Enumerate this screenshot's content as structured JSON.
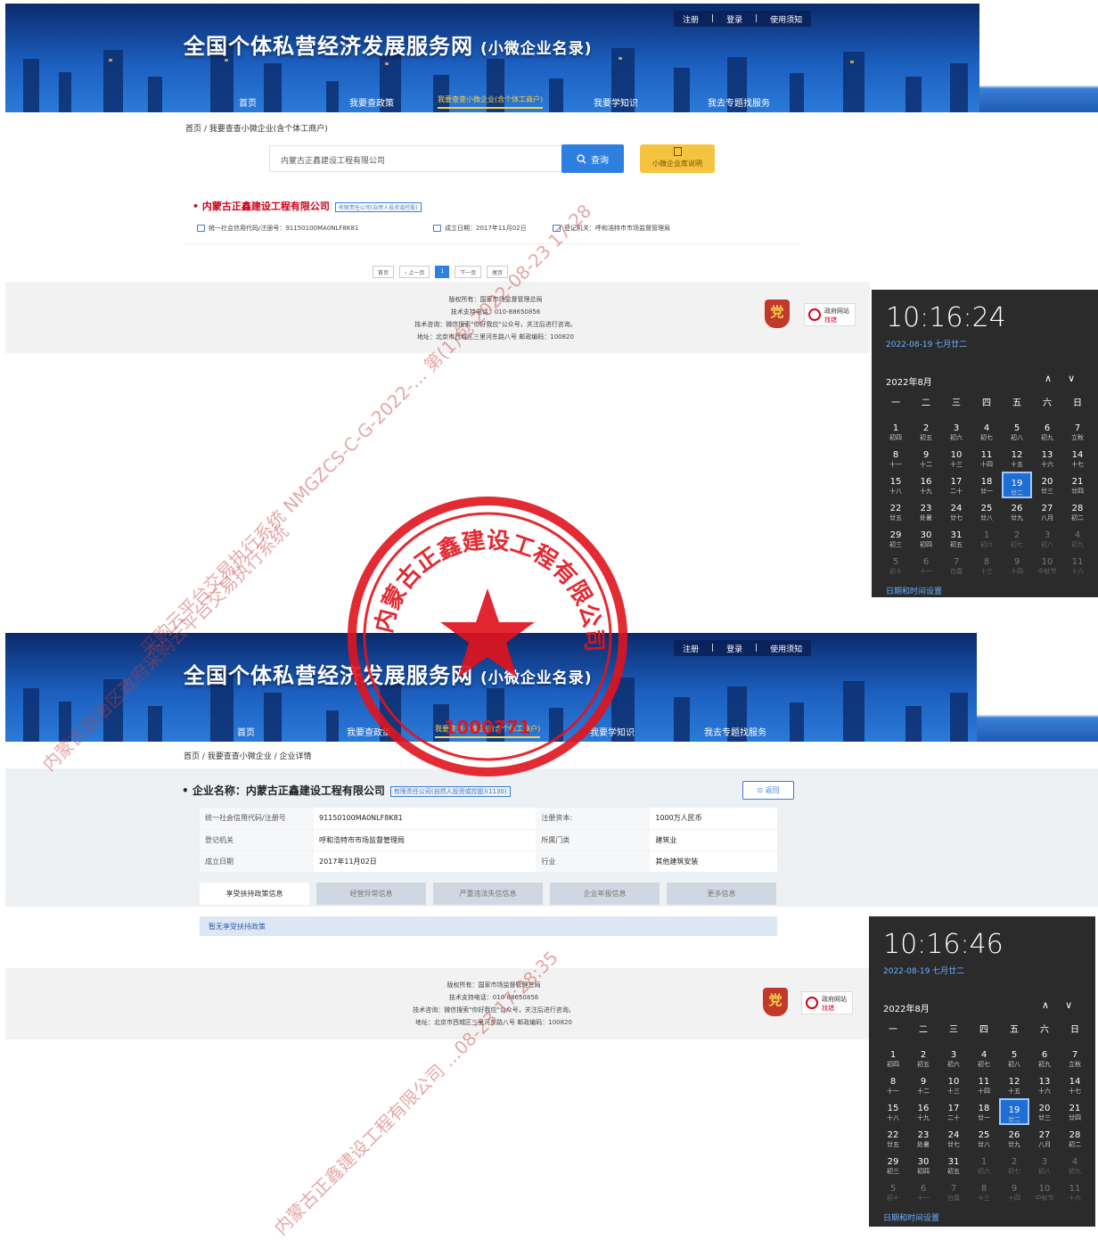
{
  "site": {
    "title": "全国个体私营经济发展服务网",
    "subtitle": "(小微企业名录)",
    "top_links": [
      "注册",
      "|",
      "登录",
      "|",
      "使用须知"
    ],
    "nav": [
      "首页",
      "我要查政策",
      "我要查查小微企业(含个体工商户)",
      "我要学知识",
      "我去专题找服务"
    ]
  },
  "page1": {
    "breadcrumb": "首页 / 我要查查小微企业(含个体工商户)",
    "search": {
      "value": "内蒙古正鑫建设工程有限公司",
      "button": "查询",
      "guide_button": "小微企业库说明"
    },
    "result": {
      "name": "内蒙古正鑫建设工程有限公司",
      "tag": "有限责任公司(自然人投资或控股)",
      "credit_code": "统一社会信用代码/注册号：91150100MA0NLF8K81",
      "founded": "成立日期：2017年11月02日",
      "registrar": "登记机关：呼和浩特市市场监督管理局"
    },
    "pager": [
      "首页",
      "‹ 上一页",
      "1",
      "下一页",
      "尾页"
    ]
  },
  "page2": {
    "breadcrumb": "首页 / 我要查查小微企业 / 企业详情",
    "company_label": "企业名称：内蒙古正鑫建设工程有限公司",
    "tag": "有限责任公司(自然人投资或控股)(1130)",
    "back_button": "返回",
    "info_rows": [
      [
        "统一社会信用代码/注册号",
        "91150100MA0NLF8K81",
        "注册资本:",
        "1000万人民币"
      ],
      [
        "登记机关",
        "呼和浩特市市场监督管理局",
        "所属门类",
        "建筑业"
      ],
      [
        "成立日期",
        "2017年11月02日",
        "行业",
        "其他建筑安装"
      ]
    ],
    "tabs": [
      "享受扶持政策信息",
      "经营异常信息",
      "严重违法失信信息",
      "企业年报信息",
      "更多信息"
    ],
    "no_policy": "暂无享受扶持政策"
  },
  "footer": {
    "lines": [
      "版权所有：国家市场监督管理总局",
      "技术支持电话：010-88650856",
      "技术咨询：微信搜索\"你好我应\"公众号，关注后进行咨询。",
      "地址：北京市西城区三里河东路八号 邮政编码：100820"
    ],
    "badge_label": "党",
    "gov_button": [
      "政府网站",
      "找错"
    ]
  },
  "clock1": {
    "time": "10:16:24",
    "date": "2022-08-19 七月廿二"
  },
  "clock2": {
    "time": "10:16:46",
    "date": "2022-08-19 七月廿二"
  },
  "calendar": {
    "month": "2022年8月",
    "arrows": [
      "∧",
      "∨"
    ],
    "weekdays": [
      "一",
      "二",
      "三",
      "四",
      "五",
      "六",
      "日"
    ],
    "days": [
      [
        "1",
        "初四"
      ],
      [
        "2",
        "初五"
      ],
      [
        "3",
        "初六"
      ],
      [
        "4",
        "初七"
      ],
      [
        "5",
        "初八"
      ],
      [
        "6",
        "初九"
      ],
      [
        "7",
        "立秋"
      ],
      [
        "8",
        "十一"
      ],
      [
        "9",
        "十二"
      ],
      [
        "10",
        "十三"
      ],
      [
        "11",
        "十四"
      ],
      [
        "12",
        "十五"
      ],
      [
        "13",
        "十六"
      ],
      [
        "14",
        "十七"
      ],
      [
        "15",
        "十八"
      ],
      [
        "16",
        "十九"
      ],
      [
        "17",
        "二十"
      ],
      [
        "18",
        "廿一"
      ],
      [
        "19",
        "廿二"
      ],
      [
        "20",
        "廿三"
      ],
      [
        "21",
        "廿四"
      ],
      [
        "22",
        "廿五"
      ],
      [
        "23",
        "处暑"
      ],
      [
        "24",
        "廿七"
      ],
      [
        "25",
        "廿八"
      ],
      [
        "26",
        "廿九"
      ],
      [
        "27",
        "八月"
      ],
      [
        "28",
        "初二"
      ],
      [
        "29",
        "初三"
      ],
      [
        "30",
        "初四"
      ],
      [
        "31",
        "初五"
      ],
      [
        "1",
        "初六"
      ],
      [
        "2",
        "初七"
      ],
      [
        "3",
        "初八"
      ],
      [
        "4",
        "初九"
      ],
      [
        "5",
        "初十"
      ],
      [
        "6",
        "十一"
      ],
      [
        "7",
        "白露"
      ],
      [
        "8",
        "十三"
      ],
      [
        "9",
        "十四"
      ],
      [
        "10",
        "中秋节"
      ],
      [
        "11",
        "十六"
      ]
    ],
    "today": "19",
    "settings_link": "日期和时间设置"
  },
  "seal": {
    "center_number": "1000771",
    "ring_text": "内蒙古正鑫建设工程有限公司"
  },
  "watermarks": [
    "采购云平台交易执行系统 NMGZCS-C-G-2022-... 第(1)包 2022-08-23 17:28",
    "内蒙古自治区政府采购云平台交易执行系统",
    "内蒙古正鑫建设工程有限公司 ...08-23 17:28:35"
  ],
  "colors": {
    "accent": "#2f7fe0",
    "company_red": "#d0021b",
    "nav_active": "#ffd23f",
    "seal_red": "#e0141e"
  }
}
